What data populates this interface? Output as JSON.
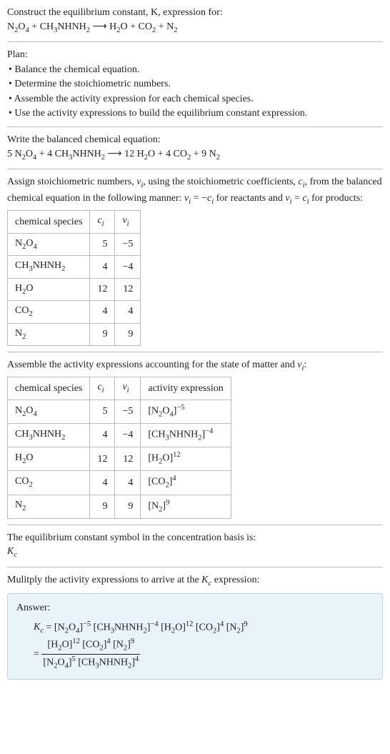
{
  "intro": {
    "line1": "Construct the equilibrium constant, K, expression for:",
    "line2_html": "N<sub>2</sub>O<sub>4</sub> + CH<sub>3</sub>NHNH<sub>2</sub> ⟶ H<sub>2</sub>O + CO<sub>2</sub> + N<sub>2</sub>"
  },
  "plan": {
    "heading": "Plan:",
    "items": [
      "• Balance the chemical equation.",
      "• Determine the stoichiometric numbers.",
      "• Assemble the activity expression for each chemical species.",
      "• Use the activity expressions to build the equilibrium constant expression."
    ]
  },
  "balanced": {
    "heading": "Write the balanced chemical equation:",
    "eq_html": "5 N<sub>2</sub>O<sub>4</sub> + 4 CH<sub>3</sub>NHNH<sub>2</sub> ⟶ 12 H<sub>2</sub>O + 4 CO<sub>2</sub> + 9 N<sub>2</sub>"
  },
  "assign": {
    "text_html": "Assign stoichiometric numbers, <i>ν<sub>i</sub></i>, using the stoichiometric coefficients, <i>c<sub>i</sub></i>, from the balanced chemical equation in the following manner: <i>ν<sub>i</sub></i> = −<i>c<sub>i</sub></i> for reactants and <i>ν<sub>i</sub></i> = <i>c<sub>i</sub></i> for products:"
  },
  "table1": {
    "headers": {
      "species": "chemical species",
      "ci_html": "<i>c<sub>i</sub></i>",
      "vi_html": "<i>ν<sub>i</sub></i>"
    },
    "rows": [
      {
        "species_html": "N<sub>2</sub>O<sub>4</sub>",
        "ci": "5",
        "vi": "−5"
      },
      {
        "species_html": "CH<sub>3</sub>NHNH<sub>2</sub>",
        "ci": "4",
        "vi": "−4"
      },
      {
        "species_html": "H<sub>2</sub>O",
        "ci": "12",
        "vi": "12"
      },
      {
        "species_html": "CO<sub>2</sub>",
        "ci": "4",
        "vi": "4"
      },
      {
        "species_html": "N<sub>2</sub>",
        "ci": "9",
        "vi": "9"
      }
    ]
  },
  "assemble": {
    "text_html": "Assemble the activity expressions accounting for the state of matter and <i>ν<sub>i</sub></i>:"
  },
  "table2": {
    "headers": {
      "species": "chemical species",
      "ci_html": "<i>c<sub>i</sub></i>",
      "vi_html": "<i>ν<sub>i</sub></i>",
      "activity": "activity expression"
    },
    "rows": [
      {
        "species_html": "N<sub>2</sub>O<sub>4</sub>",
        "ci": "5",
        "vi": "−5",
        "act_html": "[N<sub>2</sub>O<sub>4</sub>]<sup>−5</sup>"
      },
      {
        "species_html": "CH<sub>3</sub>NHNH<sub>2</sub>",
        "ci": "4",
        "vi": "−4",
        "act_html": "[CH<sub>3</sub>NHNH<sub>2</sub>]<sup>−4</sup>"
      },
      {
        "species_html": "H<sub>2</sub>O",
        "ci": "12",
        "vi": "12",
        "act_html": "[H<sub>2</sub>O]<sup>12</sup>"
      },
      {
        "species_html": "CO<sub>2</sub>",
        "ci": "4",
        "vi": "4",
        "act_html": "[CO<sub>2</sub>]<sup>4</sup>"
      },
      {
        "species_html": "N<sub>2</sub>",
        "ci": "9",
        "vi": "9",
        "act_html": "[N<sub>2</sub>]<sup>9</sup>"
      }
    ]
  },
  "symbol": {
    "line1": "The equilibrium constant symbol in the concentration basis is:",
    "line2_html": "<i>K<sub>c</sub></i>"
  },
  "multiply": {
    "text_html": "Mulitply the activity expressions to arrive at the <i>K<sub>c</sub></i> expression:"
  },
  "answer": {
    "label": "Answer:",
    "line1_html": "<i>K<sub>c</sub></i> = [N<sub>2</sub>O<sub>4</sub>]<sup>−5</sup> [CH<sub>3</sub>NHNH<sub>2</sub>]<sup>−4</sup> [H<sub>2</sub>O]<sup>12</sup> [CO<sub>2</sub>]<sup>4</sup> [N<sub>2</sub>]<sup>9</sup>",
    "frac_num_html": "[H<sub>2</sub>O]<sup>12</sup> [CO<sub>2</sub>]<sup>4</sup> [N<sub>2</sub>]<sup>9</sup>",
    "frac_den_html": "[N<sub>2</sub>O<sub>4</sub>]<sup>5</sup> [CH<sub>3</sub>NHNH<sub>2</sub>]<sup>4</sup>",
    "equals": "="
  },
  "chart_data": {
    "type": "table",
    "tables": [
      {
        "columns": [
          "chemical species",
          "c_i",
          "ν_i"
        ],
        "rows": [
          [
            "N2O4",
            5,
            -5
          ],
          [
            "CH3NHNH2",
            4,
            -4
          ],
          [
            "H2O",
            12,
            12
          ],
          [
            "CO2",
            4,
            4
          ],
          [
            "N2",
            9,
            9
          ]
        ]
      },
      {
        "columns": [
          "chemical species",
          "c_i",
          "ν_i",
          "activity expression"
        ],
        "rows": [
          [
            "N2O4",
            5,
            -5,
            "[N2O4]^-5"
          ],
          [
            "CH3NHNH2",
            4,
            -4,
            "[CH3NHNH2]^-4"
          ],
          [
            "H2O",
            12,
            12,
            "[H2O]^12"
          ],
          [
            "CO2",
            4,
            4,
            "[CO2]^4"
          ],
          [
            "N2",
            9,
            9,
            "[N2]^9"
          ]
        ]
      }
    ]
  }
}
